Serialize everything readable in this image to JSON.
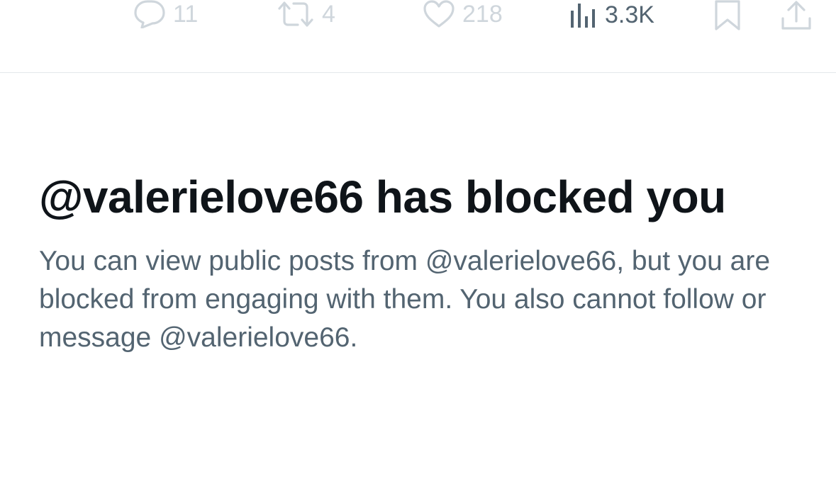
{
  "actions": {
    "reply": {
      "count": "11",
      "icon": "reply-icon"
    },
    "retweet": {
      "count": "4",
      "icon": "retweet-icon"
    },
    "like": {
      "count": "218",
      "icon": "heart-icon"
    },
    "views": {
      "count": "3.3K",
      "icon": "views-chart-icon"
    },
    "bookmark": {
      "icon": "bookmark-icon"
    },
    "share": {
      "icon": "share-icon"
    }
  },
  "blocked_notice": {
    "title": "@valerielove66 has blocked you",
    "body": "You can view public posts from @valerielove66, but you are blocked from engaging with them. You also cannot follow or message @valerielove66."
  },
  "colors": {
    "title": "#0f1419",
    "body": "#536471",
    "faded_icon": "#cfd6dc",
    "divider": "#e4e7ea"
  }
}
